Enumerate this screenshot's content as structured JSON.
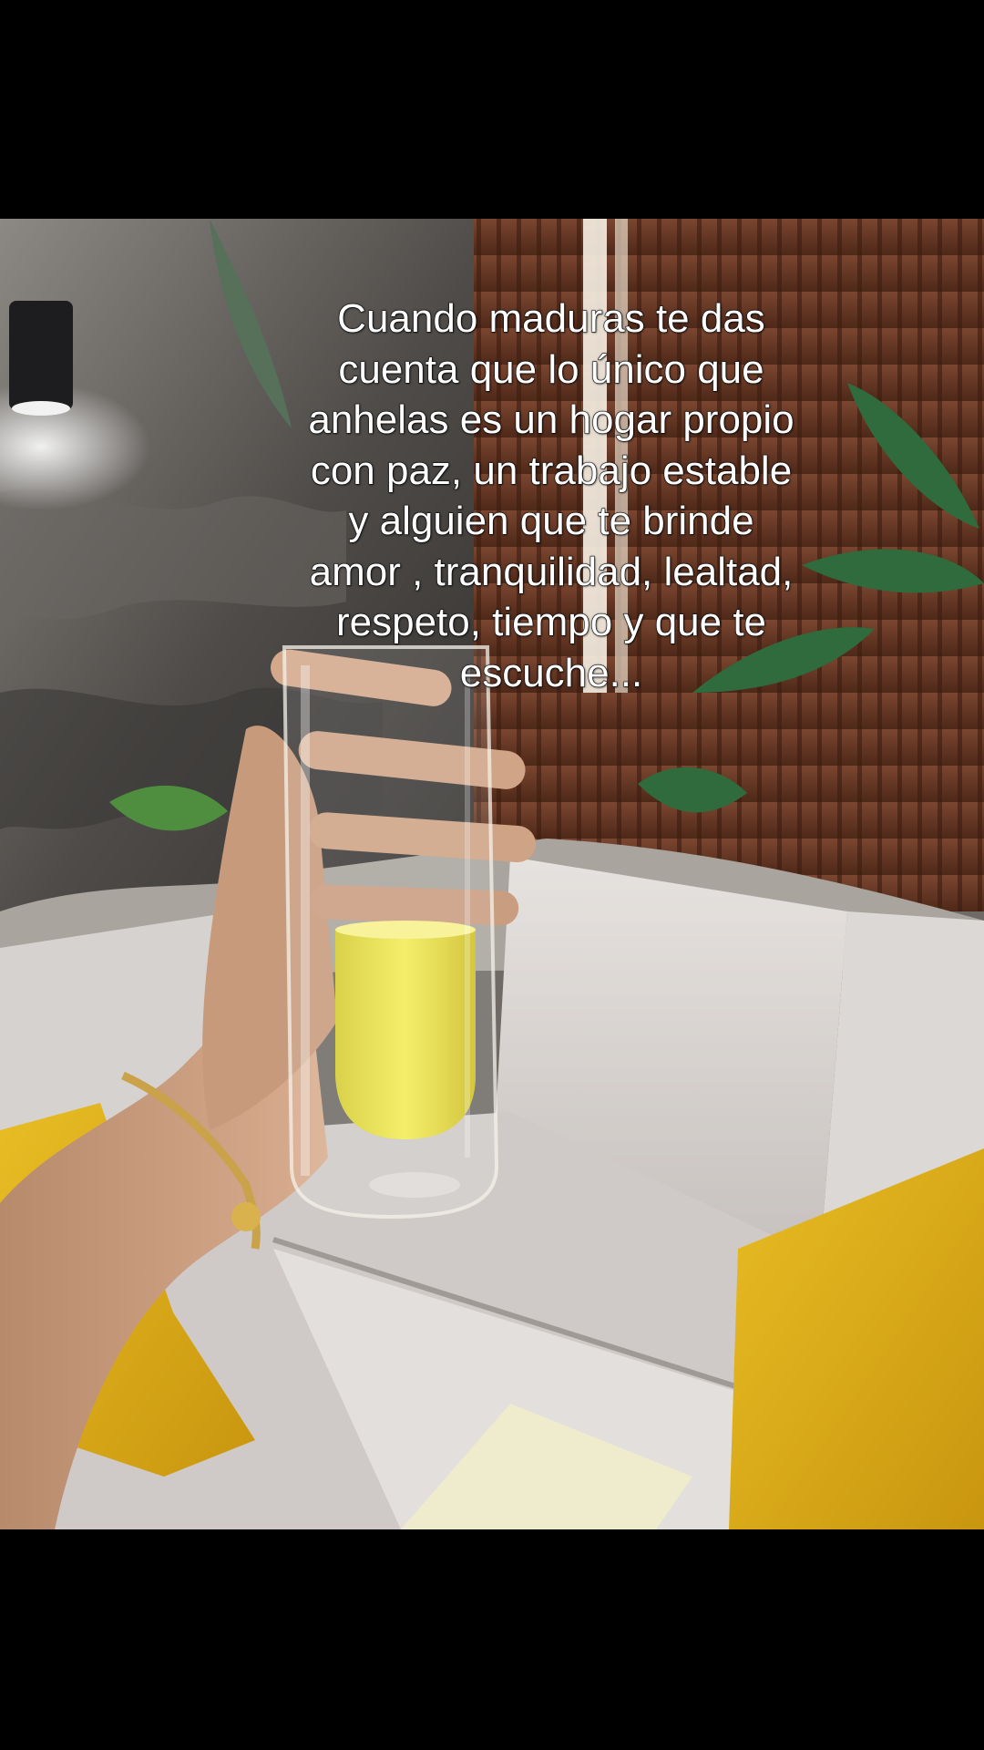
{
  "caption": {
    "lines": [
      "Cuando maduras te das",
      "cuenta que lo único que",
      "anhelas es un hogar propio",
      "con paz, un trabajo estable",
      "y alguien que te brinde",
      "amor , tranquilidad, lealtad,",
      "respeto, tiempo y que te",
      "escuche..."
    ]
  },
  "colors": {
    "letterbox": "#000000",
    "caption_text": "#ffffff",
    "cushion_yellow": "#e0b21c",
    "sofa": "#d9d5d2",
    "wood_panel": "#6b3a24",
    "stone_wall": "#4a4846",
    "drink": "#f0e64a"
  },
  "scene": {
    "objects": [
      "stone-wall",
      "wall-lamp",
      "wood-slat-panel",
      "light-strip",
      "plants",
      "pebbles",
      "sofa",
      "yellow-cushions",
      "hand",
      "glass",
      "drink",
      "bracelet"
    ]
  }
}
